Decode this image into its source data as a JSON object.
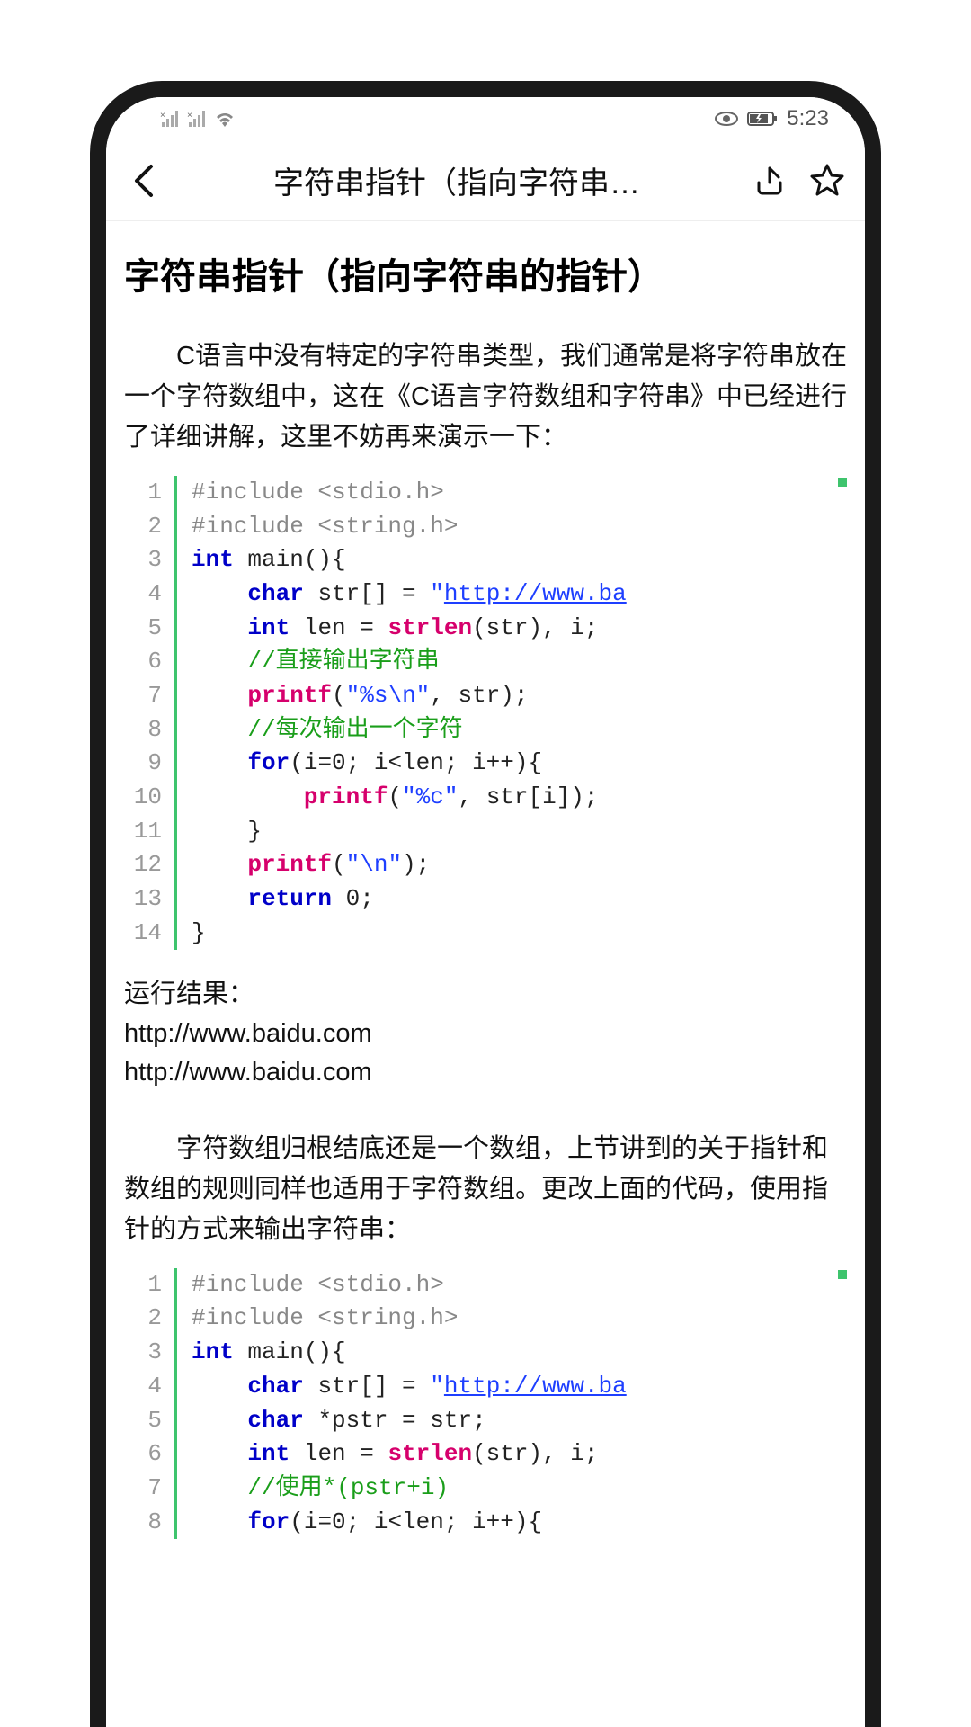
{
  "status": {
    "time": "5:23"
  },
  "header": {
    "title": "字符串指针（指向字符串…"
  },
  "article": {
    "title": "字符串指针（指向字符串的指针）",
    "para1": "C语言中没有特定的字符串类型，我们通常是将字符串放在一个字符数组中，这在《C语言字符数组和字符串》中已经进行了详细讲解，这里不妨再来演示一下：",
    "result_label": "运行结果：",
    "result_line1": "http://www.baidu.com",
    "result_line2": "http://www.baidu.com",
    "para2": "字符数组归根结底还是一个数组，上节讲到的关于指针和数组的规则同样也适用于字符数组。更改上面的代码，使用指针的方式来输出字符串："
  },
  "code1": {
    "lines": [
      "1",
      "2",
      "3",
      "4",
      "5",
      "6",
      "7",
      "8",
      "9",
      "10",
      "11",
      "12",
      "13",
      "14"
    ],
    "l1": "#include <stdio.h>",
    "l2": "#include <string.h>",
    "l3_int": "int",
    "l3_rest": " main(){",
    "l4_char": "char",
    "l4_mid": " str[] = ",
    "l4_q": "\"",
    "l4_link": "http://www.ba",
    "l5_int": "int",
    "l5_mid": " len = ",
    "l5_fn": "strlen",
    "l5_end": "(str), i;",
    "l6": "//直接输出字符串",
    "l7_fn": "printf",
    "l7_args": "(",
    "l7_str": "\"%s\\n\"",
    "l7_end": ", str);",
    "l8": "//每次输出一个字符",
    "l9_for": "for",
    "l9_rest": "(i=0; i<len; i++){",
    "l10_fn": "printf",
    "l10_args": "(",
    "l10_str": "\"%c\"",
    "l10_end": ", str[i]);",
    "l11": "}",
    "l12_fn": "printf",
    "l12_args": "(",
    "l12_str": "\"\\n\"",
    "l12_end": ");",
    "l13_ret": "return",
    "l13_rest": " 0;",
    "l14": "}"
  },
  "code2": {
    "lines": [
      "1",
      "2",
      "3",
      "4",
      "5",
      "6",
      "7",
      "8"
    ],
    "l1": "#include <stdio.h>",
    "l2": "#include <string.h>",
    "l3_int": "int",
    "l3_rest": " main(){",
    "l4_char": "char",
    "l4_mid": " str[] = ",
    "l4_q": "\"",
    "l4_link": "http://www.ba",
    "l5_char": "char",
    "l5_rest": " *pstr = str;",
    "l6_int": "int",
    "l6_mid": " len = ",
    "l6_fn": "strlen",
    "l6_end": "(str), i;",
    "l7": "//使用*(pstr+i)",
    "l8_for": "for",
    "l8_rest": "(i=0; i<len; i++){"
  }
}
